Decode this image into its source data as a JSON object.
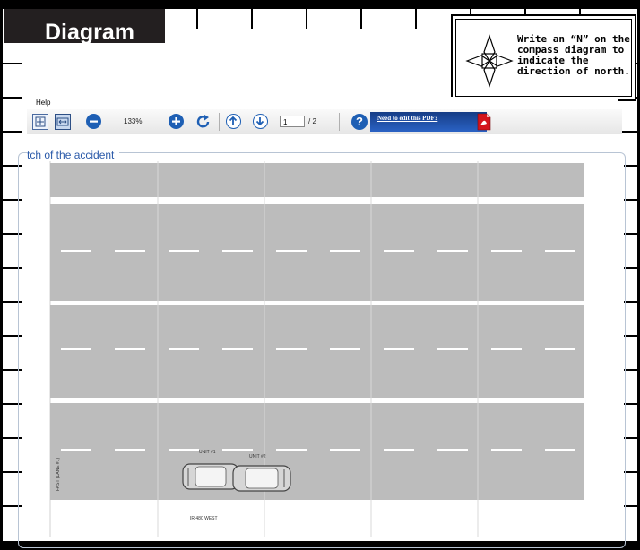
{
  "worksheet": {
    "title": "Diagram",
    "compass_instruction": "Write an “N” on the compass diagram to indicate the direction of north.",
    "compass_icon": "compass-rose-icon"
  },
  "viewer": {
    "menu": {
      "help_label": "Help"
    },
    "toolbar": {
      "fit_page_icon": "fit-page-icon",
      "fit_width_icon": "fit-width-icon",
      "zoom_out_icon": "minus-circle-icon",
      "zoom_level": "133%",
      "zoom_in_icon": "plus-circle-icon",
      "rotate_icon": "rotate-clockwise-icon",
      "prev_page_icon": "arrow-up-circle-icon",
      "next_page_icon": "arrow-down-circle-icon",
      "current_page": "1",
      "total_pages": "/ 2",
      "help_icon_text": "?",
      "edit_link": "Need to edit this PDF?",
      "adobe_icon": "adobe-pdf-icon",
      "colors": {
        "banner": "#1f4fa6",
        "button_blue": "#1e5fb4",
        "road": "#bcbcbc"
      }
    }
  },
  "form": {
    "section_label": "tch of the accident",
    "sketch": {
      "unit1_label": "UNIT #1",
      "unit2_label": "UNIT #2",
      "lane_label": "FAST (LANE #1)",
      "road_label": "IR 480 WEST"
    }
  }
}
